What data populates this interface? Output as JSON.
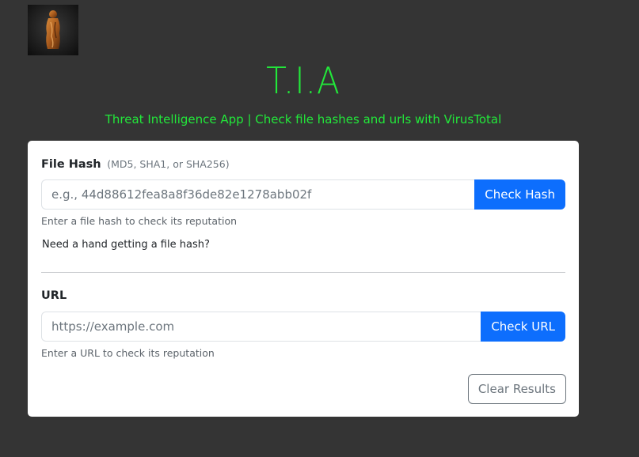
{
  "header": {
    "logo_icon": "tia-logo-image",
    "title": "T.I.A",
    "subtitle": "Threat Intelligence App | Check file hashes and urls with VirusTotal"
  },
  "colors": {
    "background": "#343434",
    "accent_green": "#22e83a",
    "primary_blue": "#0d6efd",
    "secondary_gray": "#6c757d"
  },
  "hash_section": {
    "label": "File Hash",
    "label_hint": "(MD5, SHA1, or SHA256)",
    "input_value": "",
    "input_placeholder": "e.g., 44d88612fea8a8f36de82e1278abb02f",
    "button_label": "Check Hash",
    "help_text": "Enter a file hash to check its reputation",
    "link_text": "Need a hand getting a file hash?"
  },
  "url_section": {
    "label": "URL",
    "input_value": "",
    "input_placeholder": "https://example.com",
    "button_label": "Check URL",
    "help_text": "Enter a URL to check its reputation"
  },
  "actions": {
    "clear_label": "Clear Results"
  }
}
